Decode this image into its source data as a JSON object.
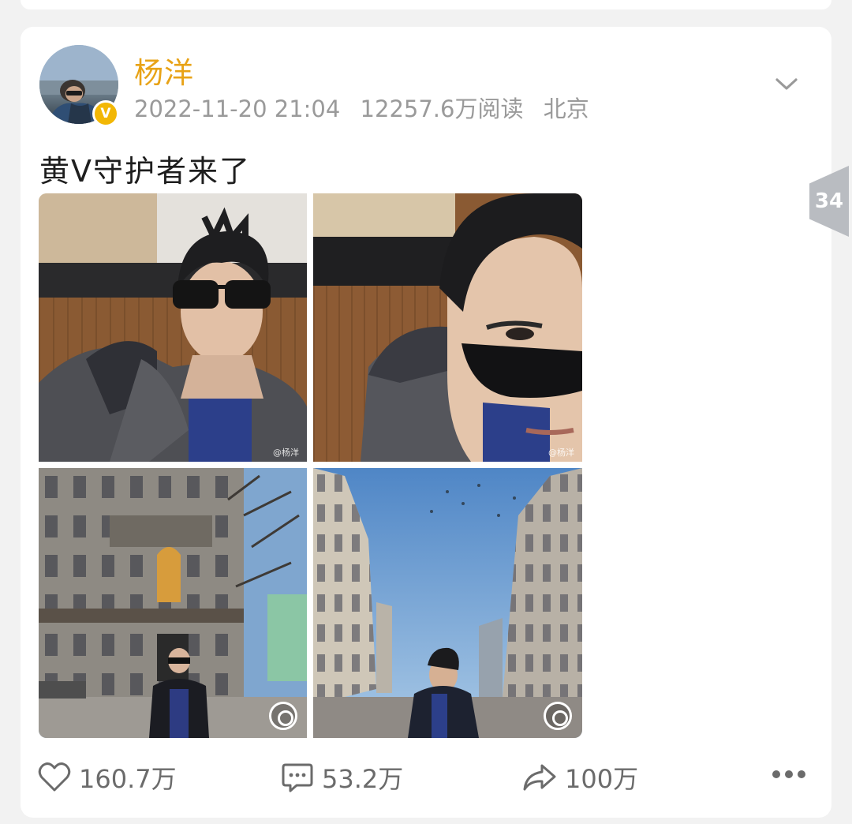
{
  "post": {
    "author": "杨洋",
    "verified_badge": "V",
    "timestamp": "2022-11-20 21:04",
    "reads": "12257.6万阅读",
    "location": "北京",
    "text": "黄V守护者来了",
    "side_tab_count": "34",
    "photo_watermark": "@杨洋"
  },
  "actions": {
    "like_count": "160.7万",
    "comment_count": "53.2万",
    "repost_count": "100万"
  },
  "colors": {
    "username": "#e8a317",
    "verified_badge": "#f2b705",
    "meta_text": "#9a9a9a",
    "action_text": "#6b6b6b"
  },
  "icons": [
    "chevron-down-icon",
    "heart-icon",
    "comment-icon",
    "share-icon",
    "more-dots-icon",
    "live-photo-icon"
  ]
}
